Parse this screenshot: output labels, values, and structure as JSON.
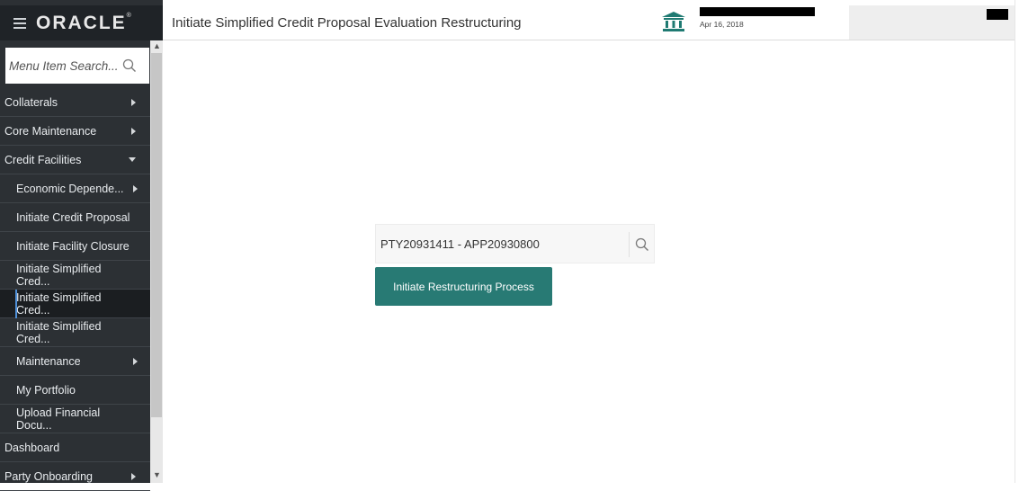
{
  "brand": {
    "name": "ORACLE",
    "mark": "®"
  },
  "search": {
    "placeholder": "Menu Item Search..."
  },
  "menu": [
    {
      "label": "Collaterals",
      "level": 0,
      "arrow": "right"
    },
    {
      "label": "Core Maintenance",
      "level": 0,
      "arrow": "right"
    },
    {
      "label": "Credit Facilities",
      "level": 0,
      "arrow": "down"
    },
    {
      "label": "Economic Depende...",
      "level": 1,
      "arrow": "right"
    },
    {
      "label": "Initiate Credit Proposal",
      "level": 1,
      "arrow": ""
    },
    {
      "label": "Initiate Facility Closure",
      "level": 1,
      "arrow": ""
    },
    {
      "label": "Initiate Simplified Cred...",
      "level": 1,
      "arrow": ""
    },
    {
      "label": "Initiate Simplified Cred...",
      "level": 1,
      "arrow": "",
      "active": true
    },
    {
      "label": "Initiate Simplified Cred...",
      "level": 1,
      "arrow": ""
    },
    {
      "label": "Maintenance",
      "level": 1,
      "arrow": "right"
    },
    {
      "label": "My Portfolio",
      "level": 1,
      "arrow": ""
    },
    {
      "label": "Upload Financial Docu...",
      "level": 1,
      "arrow": ""
    },
    {
      "label": "Dashboard",
      "level": 0,
      "arrow": ""
    },
    {
      "label": "Party Onboarding",
      "level": 0,
      "arrow": "right"
    }
  ],
  "header": {
    "title": "Initiate Simplified Credit Proposal Evaluation Restructuring",
    "date": "Apr 16, 2018"
  },
  "main": {
    "application_value": "PTY20931411 - APP20930800",
    "initiate_button": "Initiate Restructuring Process"
  },
  "colors": {
    "sidebar_bg": "#2c3034",
    "accent_teal": "#287a74",
    "bank_icon": "#1f7a72",
    "active_marker": "#4f8fd6"
  }
}
